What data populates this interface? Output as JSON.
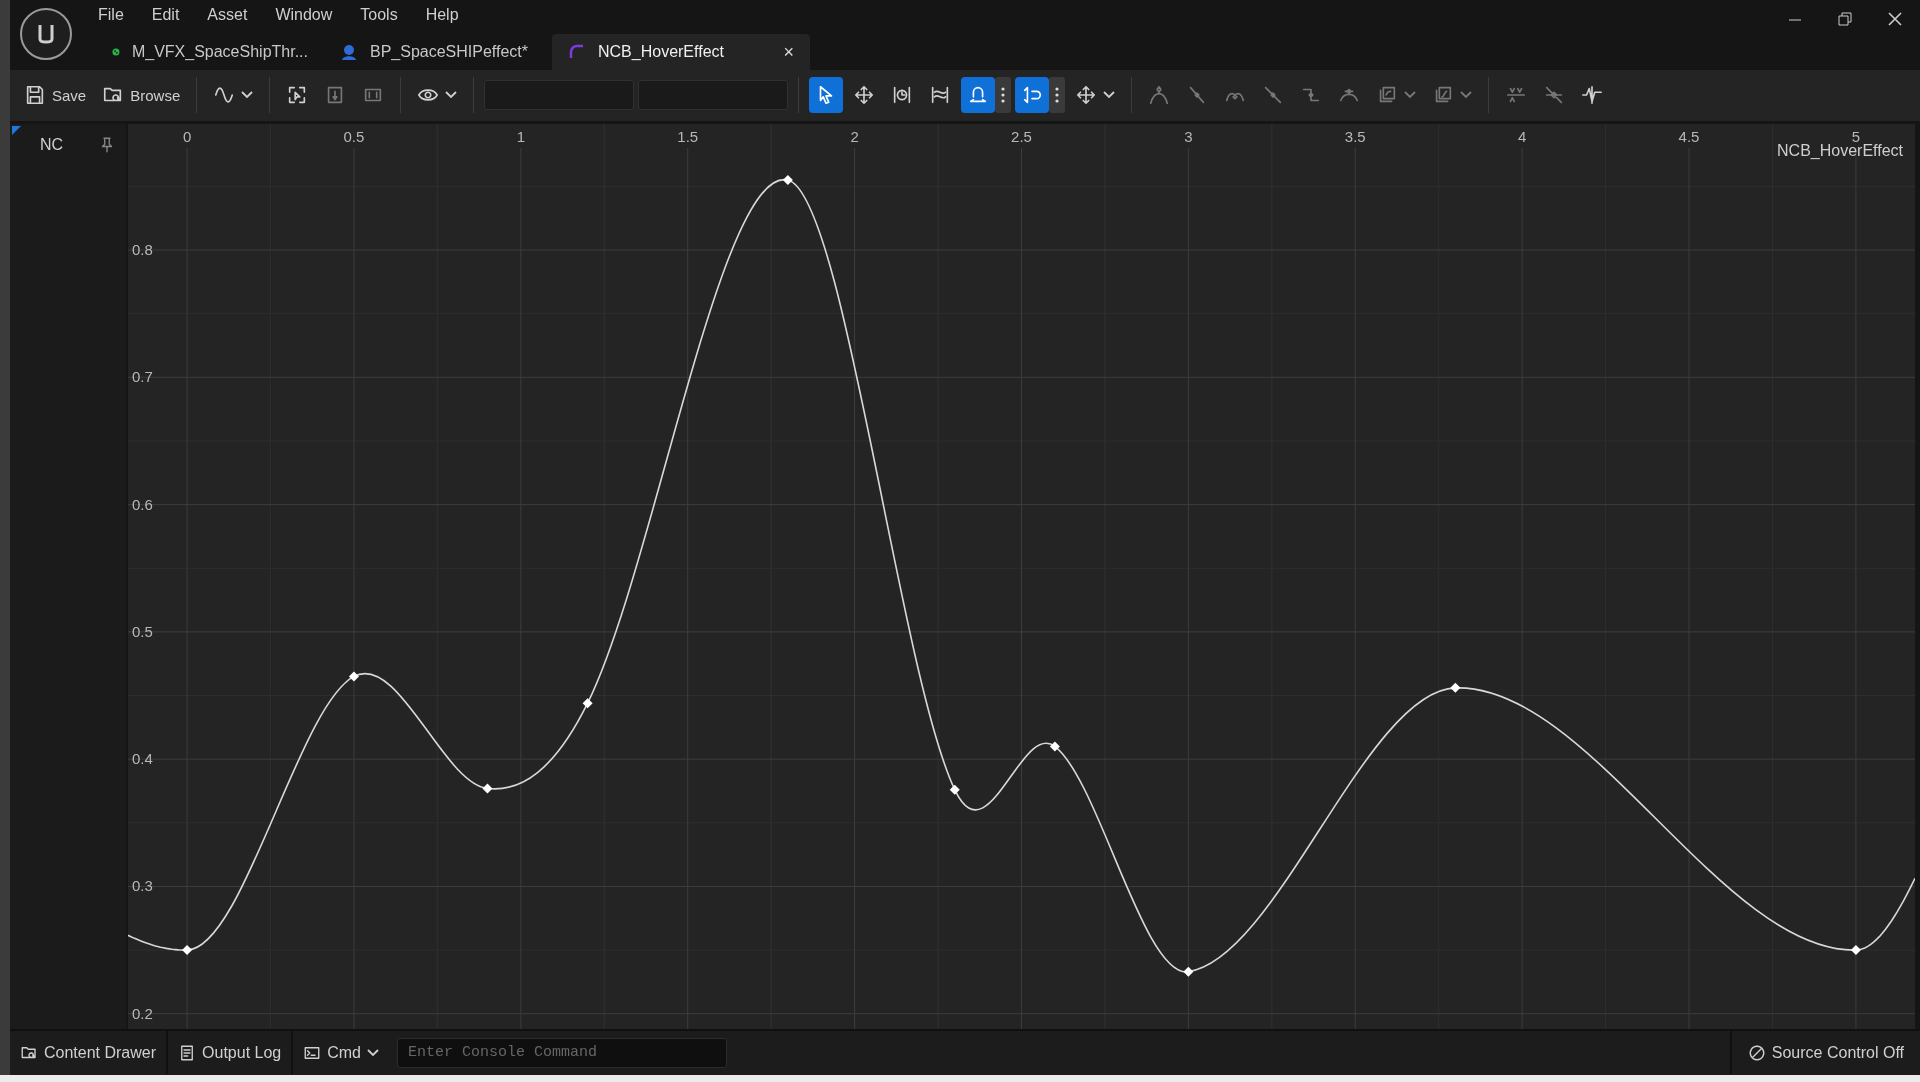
{
  "menu": [
    "File",
    "Edit",
    "Asset",
    "Window",
    "Tools",
    "Help"
  ],
  "tabs": [
    {
      "label": "M_VFX_SpaceShipThr...",
      "kind": "material",
      "selected": false
    },
    {
      "label": "BP_SpaceSHIPeffect*",
      "kind": "blueprint",
      "selected": false
    },
    {
      "label": "NCB_HoverEffect",
      "kind": "curve",
      "selected": true,
      "close": "×"
    }
  ],
  "toolbar": {
    "save": "Save",
    "browse": "Browse",
    "tools": [
      {
        "selected": false,
        "disabled": false
      },
      {
        "selected": false,
        "disabled": false
      },
      {
        "selected": false,
        "disabled": true
      },
      {
        "selected": false,
        "disabled": true
      },
      {
        "selected": false,
        "disabled": false
      },
      {
        "selected": true,
        "disabled": false
      },
      {
        "selected": false,
        "disabled": false
      },
      {
        "selected": false,
        "disabled": false
      },
      {
        "selected": false,
        "disabled": false
      },
      {
        "selected": true,
        "disabled": false
      },
      {
        "selected": true,
        "disabled": false
      },
      {
        "selected": false,
        "disabled": false
      },
      {
        "selected": false,
        "disabled": true
      },
      {
        "selected": false,
        "disabled": true
      },
      {
        "selected": false,
        "disabled": true
      },
      {
        "selected": false,
        "disabled": true
      },
      {
        "selected": false,
        "disabled": true
      },
      {
        "selected": false,
        "disabled": true
      },
      {
        "selected": false,
        "disabled": true
      },
      {
        "selected": false,
        "disabled": true
      },
      {
        "selected": false,
        "disabled": true
      },
      {
        "selected": false,
        "disabled": true
      },
      {
        "selected": false,
        "disabled": false
      }
    ]
  },
  "curve_editor": {
    "chart_data": {
      "type": "line",
      "title": "NCB_HoverEffect",
      "grid": true,
      "x": [
        0,
        0.5,
        0.9,
        1.2,
        1.8,
        2.3,
        2.6,
        3.0,
        3.8,
        5.0
      ],
      "series": [
        {
          "name": "NC",
          "color": "#d8d8d8",
          "marker": "diamond",
          "values": [
            0.25,
            0.465,
            0.377,
            0.444,
            0.855,
            0.376,
            0.41,
            0.233,
            0.456,
            0.25
          ]
        }
      ],
      "xlim": [
        -0.177,
        5.177
      ],
      "ylim": [
        0.188,
        0.899
      ],
      "xticks": [
        0,
        {
          "value": 0.5,
          "label": "0.5"
        },
        1,
        {
          "value": 1.5,
          "label": "1.5"
        },
        2,
        {
          "value": 2.5,
          "label": "2.5"
        },
        3,
        {
          "value": 3.5,
          "label": "3.5"
        },
        4,
        {
          "value": 4.5,
          "label": "4.5"
        },
        5
      ],
      "yticks": [
        {
          "value": 0.2,
          "label": "0.2"
        },
        {
          "value": 0.3,
          "label": "0.3"
        },
        {
          "value": 0.4,
          "label": "0.4"
        },
        {
          "value": 0.5,
          "label": "0.5"
        },
        {
          "value": 0.6,
          "label": "0.6"
        },
        {
          "value": 0.7,
          "label": "0.7"
        },
        {
          "value": 0.8,
          "label": "0.8"
        }
      ]
    }
  },
  "status_bar": {
    "buttons": [
      "Content Drawer",
      "Output Log"
    ],
    "cmd": "Cmd",
    "console_placeholder": "Enter Console Command",
    "source_control": "Source Control Off"
  }
}
